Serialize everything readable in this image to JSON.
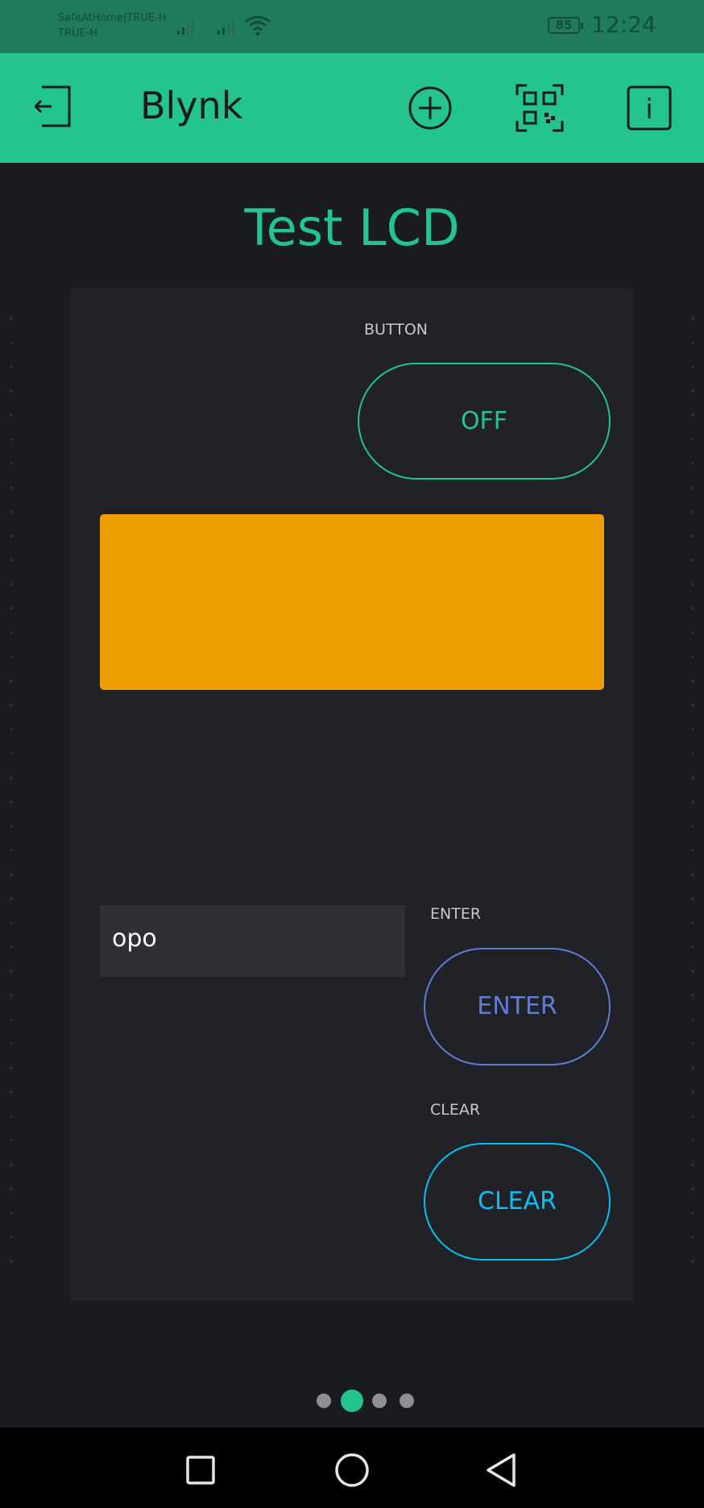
{
  "status_bar": {
    "carrier_line1": "SafeAtHome|TRUE-H",
    "carrier_line2": "TRUE-H",
    "battery": "85",
    "time": "12:24",
    "icons": [
      "signal-icon",
      "signal-icon",
      "wifi-icon"
    ]
  },
  "app_bar": {
    "title": "Blynk",
    "icons": [
      "logout-icon",
      "add-icon",
      "qr-scan-icon",
      "info-icon"
    ]
  },
  "project": {
    "title": "Test LCD",
    "widgets": {
      "button": {
        "label": "BUTTON",
        "state": "OFF",
        "color": "#23c48e"
      },
      "lcd": {
        "color": "#ed9d00"
      },
      "text_input": {
        "value": "opo"
      },
      "enter": {
        "label": "ENTER",
        "text": "ENTER",
        "color": "#5f7cd8"
      },
      "clear": {
        "label": "CLEAR",
        "text": "CLEAR",
        "color": "#04c0f8"
      }
    }
  },
  "pager": {
    "pages": 4,
    "active": 2
  },
  "nav": {
    "icons": [
      "recents-icon",
      "home-icon",
      "back-icon"
    ]
  }
}
